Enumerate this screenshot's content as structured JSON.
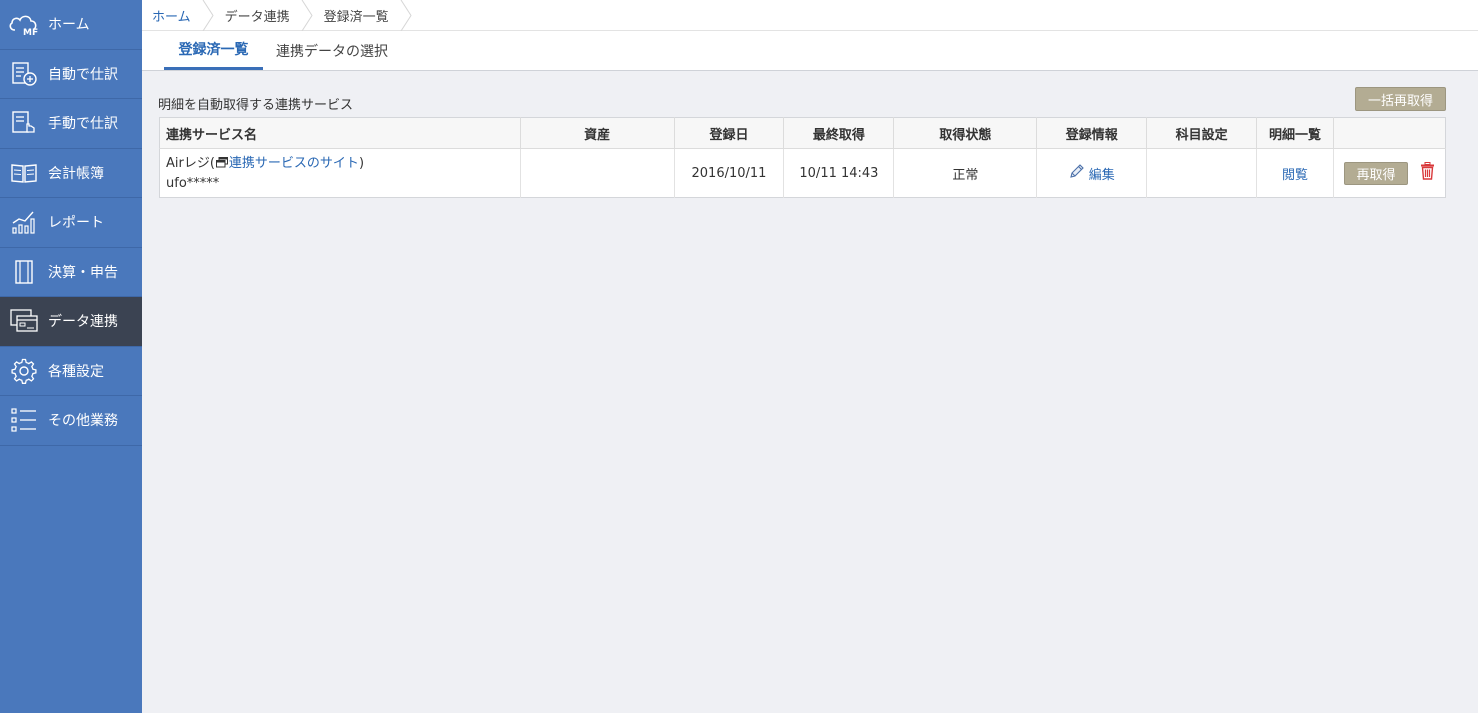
{
  "sidebar": {
    "items": [
      {
        "label": "ホーム",
        "icon": "cloud-mf-logo-icon"
      },
      {
        "label": "自動で仕訳",
        "icon": "auto-journal-icon"
      },
      {
        "label": "手動で仕訳",
        "icon": "manual-journal-icon"
      },
      {
        "label": "会計帳簿",
        "icon": "ledger-book-icon"
      },
      {
        "label": "レポート",
        "icon": "report-chart-icon"
      },
      {
        "label": "決算・申告",
        "icon": "settlement-icon"
      },
      {
        "label": "データ連携",
        "icon": "data-link-icon",
        "active": true
      },
      {
        "label": "各種設定",
        "icon": "gear-icon"
      },
      {
        "label": "その他業務",
        "icon": "list-icon"
      }
    ]
  },
  "breadcrumb": [
    "ホーム",
    "データ連携",
    "登録済一覧"
  ],
  "tabs": [
    {
      "label": "登録済一覧",
      "active": true
    },
    {
      "label": "連携データの選択",
      "active": false
    }
  ],
  "main": {
    "section_title": "明細を自動取得する連携サービス",
    "bulk_refetch_label": "一括再取得",
    "table": {
      "headers": [
        "連携サービス名",
        "資産",
        "登録日",
        "最終取得",
        "取得状態",
        "登録情報",
        "科目設定",
        "明細一覧",
        ""
      ],
      "rows": [
        {
          "service_name": "Airレジ(",
          "service_link": "連携サービスのサイト",
          "service_close": ")",
          "account": "ufo*****",
          "asset": "",
          "registered": "2016/10/11",
          "last_fetch": "10/11 14:43",
          "status": "正常",
          "edit_label": "編集",
          "subject_setting": "",
          "view_label": "閲覧",
          "refetch_label": "再取得"
        }
      ]
    }
  },
  "colors": {
    "sidebar_bg": "#4a78bc",
    "sidebar_active": "#3b4352",
    "link": "#2a68b4",
    "button": "#b3ac93",
    "delete": "#d9393b"
  }
}
